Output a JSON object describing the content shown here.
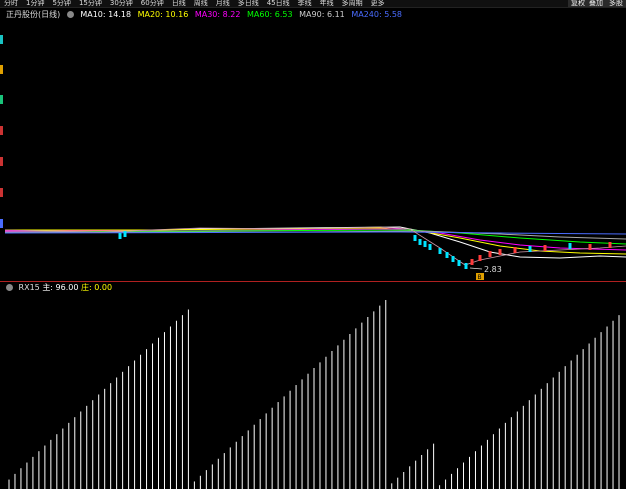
{
  "toolbar": {
    "periods": [
      "分时",
      "1分钟",
      "5分钟",
      "15分钟",
      "30分钟",
      "60分钟",
      "日线",
      "周线",
      "月线",
      "多日线",
      "45日线",
      "季线",
      "年线",
      "多周期",
      "更多"
    ],
    "right_buttons": [
      "复权",
      "叠加",
      "多股"
    ]
  },
  "stock": {
    "name": "正丹股份(日线)"
  },
  "ma": [
    {
      "label": "MA10: 14.18",
      "color": "#ffffff"
    },
    {
      "label": "MA20: 10.16",
      "color": "#ffff00"
    },
    {
      "label": "MA30: 8.22",
      "color": "#ff00ff"
    },
    {
      "label": "MA60: 6.53",
      "color": "#00ff00"
    },
    {
      "label": "MA90: 6.11",
      "color": "#cccccc"
    },
    {
      "label": "MA240: 5.58",
      "color": "#4a6cff"
    }
  ],
  "indicator": {
    "name": "RX15",
    "param1": "主: 96.00",
    "param2": "庄: 0.00"
  },
  "price_annotation": {
    "low_label": "2.83",
    "marker": "B"
  },
  "colors": {
    "up": "#ff3b3b",
    "down": "#00e5ff",
    "divider": "#b02020"
  },
  "chart_data": {
    "type": "bar",
    "title": "RX15",
    "x": [],
    "series": [
      {
        "name": "主",
        "values": [
          5,
          8,
          11,
          14,
          17,
          20,
          23,
          26,
          29,
          32,
          35,
          38,
          41,
          44,
          47,
          50,
          53,
          56,
          59,
          62,
          65,
          68,
          71,
          74,
          77,
          80,
          83,
          86,
          89,
          92,
          95,
          4,
          7,
          10,
          13,
          16,
          19,
          22,
          25,
          28,
          31,
          34,
          37,
          40,
          43,
          46,
          49,
          52,
          55,
          58,
          61,
          64,
          67,
          70,
          73,
          76,
          79,
          82,
          85,
          88,
          91,
          94,
          97,
          100,
          3,
          6,
          9,
          12,
          15,
          18,
          21,
          24,
          2,
          5,
          8,
          11,
          14,
          17,
          20,
          23,
          26,
          29,
          32,
          35,
          38,
          41,
          44,
          47,
          50,
          53,
          56,
          59,
          62,
          65,
          68,
          71,
          74,
          77,
          80,
          83,
          86,
          89,
          92
        ]
      }
    ],
    "ylim": [
      0,
      100
    ]
  }
}
